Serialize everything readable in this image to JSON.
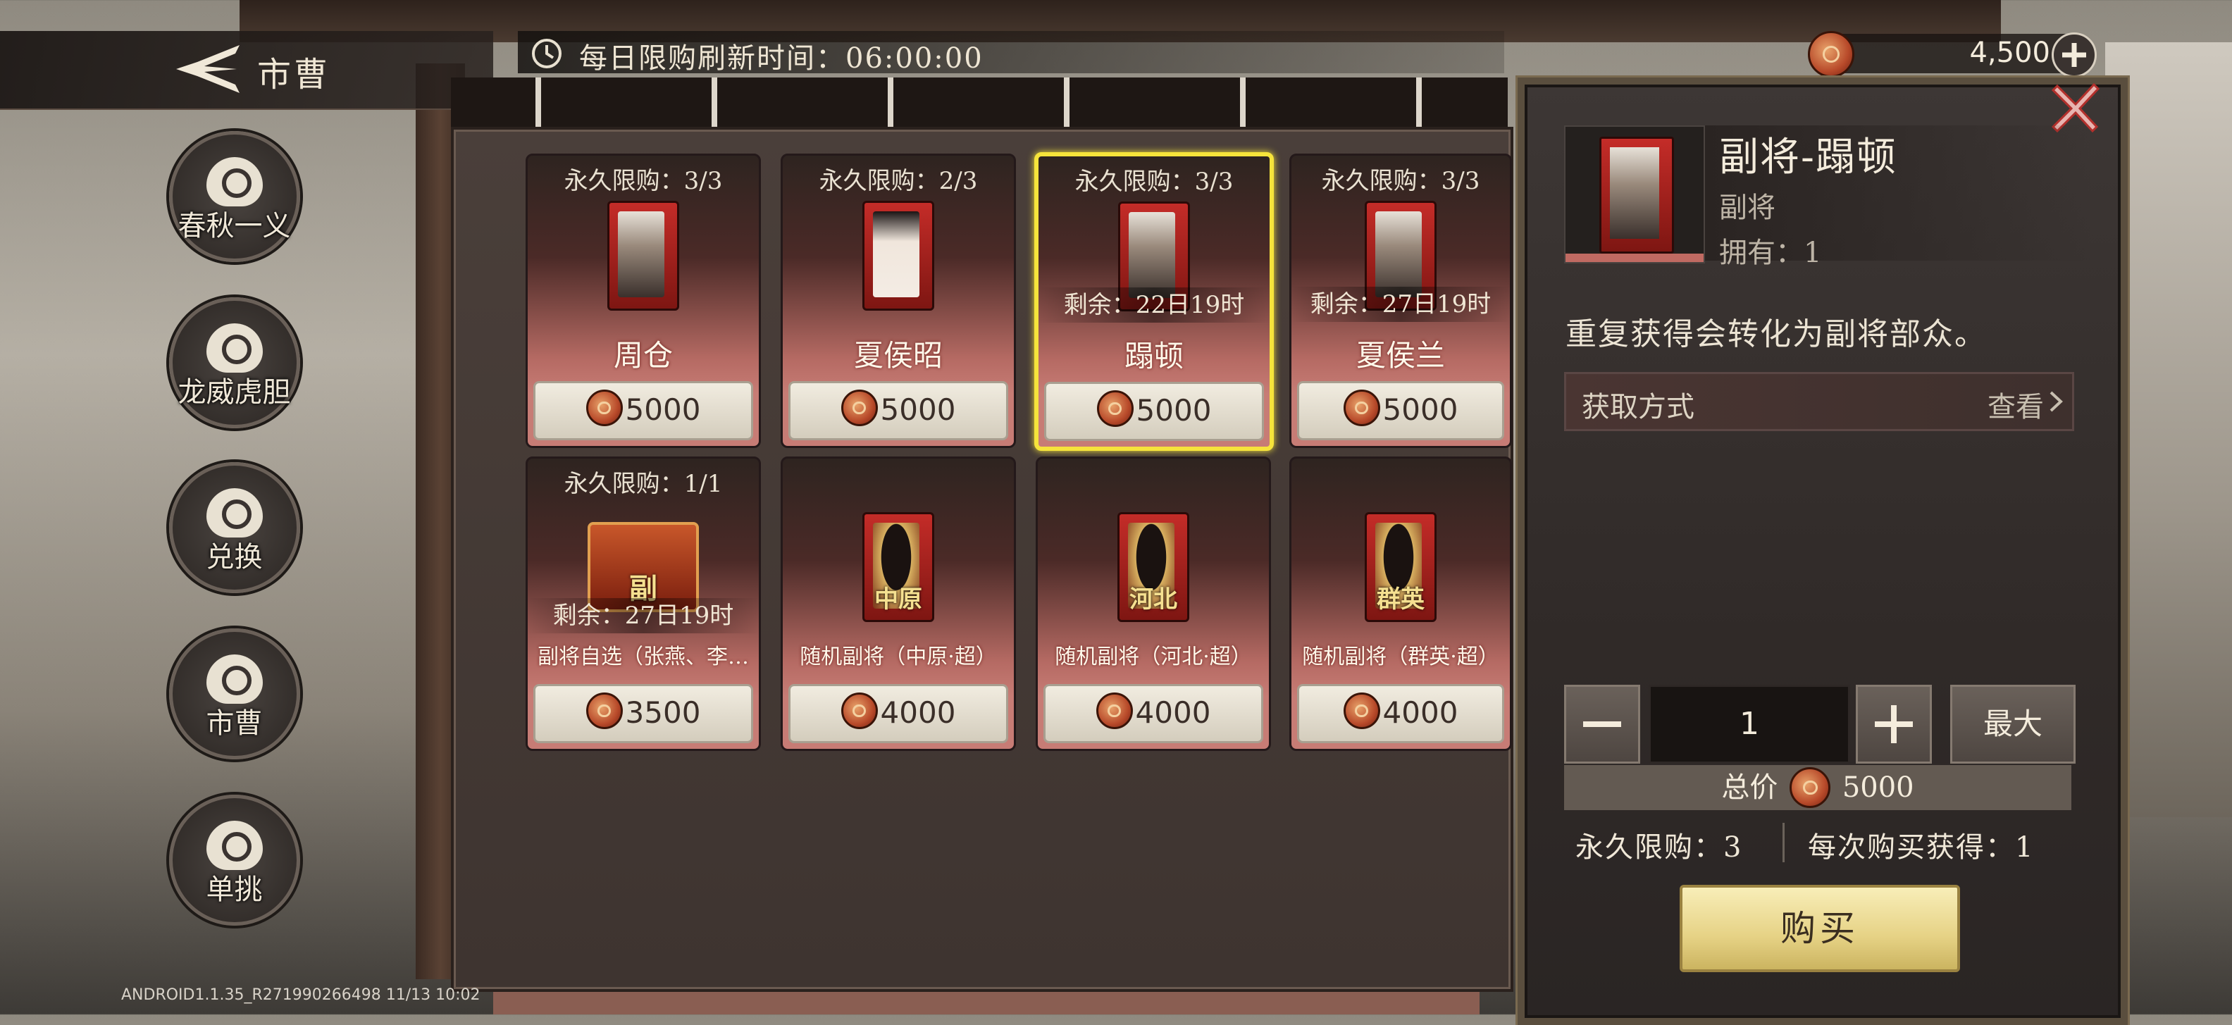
{
  "header": {
    "title": "市曹",
    "refresh_text": "每日限购刷新时间：06:00:00"
  },
  "currency": {
    "amount": "4,500"
  },
  "nav": [
    {
      "label": "春秋一义"
    },
    {
      "label": "龙威虎胆"
    },
    {
      "label": "兑换"
    },
    {
      "label": "市曹"
    },
    {
      "label": "单挑"
    }
  ],
  "cards": [
    {
      "limit": "永久限购：3/3",
      "name": "周仓",
      "price": "5000"
    },
    {
      "limit": "永久限购：2/3",
      "name": "夏侯昭",
      "price": "5000"
    },
    {
      "limit": "永久限购：3/3",
      "remain": "剩余：22日19时",
      "name": "蹋顿",
      "price": "5000"
    },
    {
      "limit": "永久限购：3/3",
      "remain": "剩余：27日19时",
      "name": "夏侯兰",
      "price": "5000"
    },
    {
      "limit": "永久限购：1/1",
      "remain": "剩余：27日19时",
      "name": "副将自选（张燕、李…",
      "tag": "副",
      "price": "3500"
    },
    {
      "name": "随机副将（中原·超）",
      "tag": "中原",
      "price": "4000"
    },
    {
      "name": "随机副将（河北·超）",
      "tag": "河北",
      "price": "4000"
    },
    {
      "name": "随机副将（群英·超）",
      "tag": "群英",
      "price": "4000"
    }
  ],
  "detail": {
    "title": "副将-蹋顿",
    "type": "副将",
    "owned": "拥有：1",
    "description": "重复获得会转化为副将部众。",
    "acquire_label": "获取方式",
    "acquire_view": "查看",
    "quantity": "1",
    "max_label": "最大",
    "total_label": "总价",
    "total_value": "5000",
    "limit_info": "永久限购：3",
    "per_buy": "每次购买获得：1",
    "buy_label": "购买"
  },
  "footer": {
    "version": "ANDROID1.1.35_R271990266498 11/13 10:02"
  }
}
